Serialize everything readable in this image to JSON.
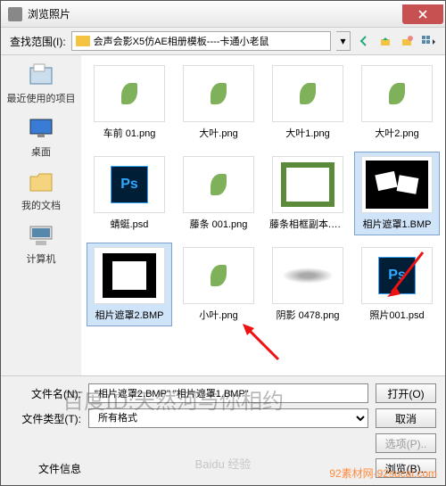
{
  "titlebar": {
    "title": "浏览照片"
  },
  "toolbar": {
    "range_label": "查找范围(I):",
    "path": "会声会影X5仿AE相册模板----卡通小老鼠"
  },
  "sidebar": {
    "items": [
      {
        "label": "最近使用的项目"
      },
      {
        "label": "桌面"
      },
      {
        "label": "我的文档"
      },
      {
        "label": "计算机"
      }
    ]
  },
  "files": [
    {
      "name": "车前 01.png",
      "type": "leaf"
    },
    {
      "name": "大叶.png",
      "type": "leaf"
    },
    {
      "name": "大叶1.png",
      "type": "leaf"
    },
    {
      "name": "大叶2.png",
      "type": "leaf"
    },
    {
      "name": "蜻蜓.psd",
      "type": "ps"
    },
    {
      "name": "藤条 001.png",
      "type": "leaf"
    },
    {
      "name": "藤条相框副本.png",
      "type": "frame"
    },
    {
      "name": "相片遮罩1.BMP",
      "type": "mask1",
      "selected": true
    },
    {
      "name": "相片遮罩2.BMP",
      "type": "mask2",
      "selected": true
    },
    {
      "name": "小叶.png",
      "type": "leaf"
    },
    {
      "name": "阴影 0478.png",
      "type": "shadow"
    },
    {
      "name": "照片001.psd",
      "type": "ps"
    }
  ],
  "bottom": {
    "filename_label": "文件名(N):",
    "filename_value": "\"相片遮罩2.BMP\" \"相片遮罩1.BMP\"",
    "filetype_label": "文件类型(T):",
    "filetype_value": "所有格式",
    "open_label": "打开(O)",
    "cancel_label": "取消",
    "options_label": "选项(P)..",
    "browse_label": "浏览(B)..",
    "fileinfo_label": "文件信息"
  },
  "watermarks": {
    "main": "百度ID:天然河与你相约",
    "center": "Baidu 经验",
    "footer": "92素材网-92sucai.com"
  }
}
